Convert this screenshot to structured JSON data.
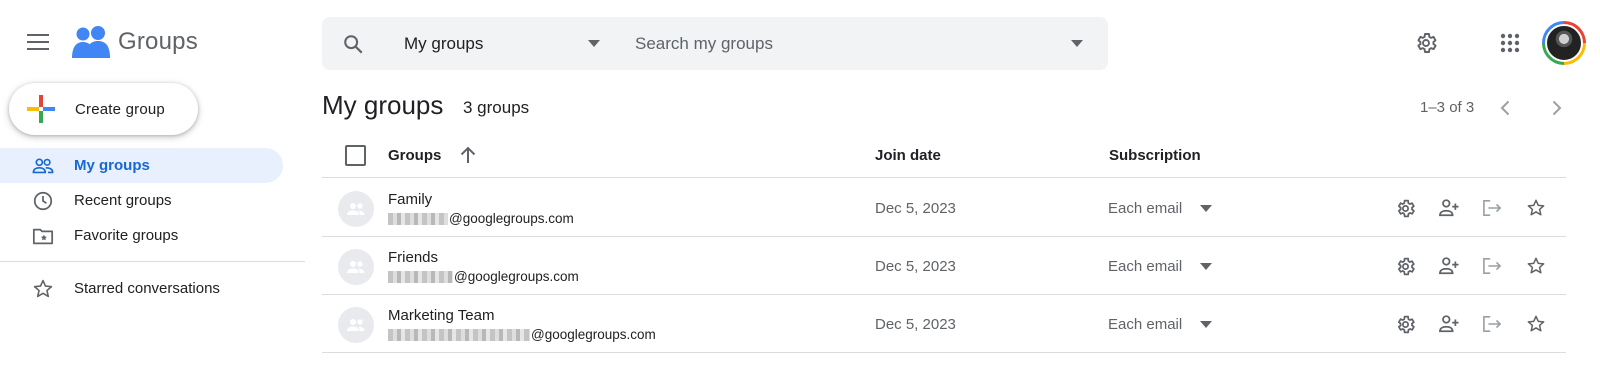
{
  "app": {
    "title": "Groups"
  },
  "search": {
    "scope": "My groups",
    "placeholder": "Search my groups"
  },
  "create_button": {
    "label": "Create group"
  },
  "sidebar": {
    "items": [
      {
        "label": "My groups",
        "icon": "people-icon",
        "active": true
      },
      {
        "label": "Recent groups",
        "icon": "clock-icon"
      },
      {
        "label": "Favorite groups",
        "icon": "folder-star-icon"
      },
      {
        "label": "Starred conversations",
        "icon": "star-icon"
      }
    ]
  },
  "main": {
    "title": "My groups",
    "count": "3 groups",
    "pagination": "1–3 of 3",
    "columns": {
      "groups": "Groups",
      "join_date": "Join date",
      "subscription": "Subscription"
    },
    "rows": [
      {
        "name": "Family",
        "email_domain": "@googlegroups.com",
        "join_date": "Dec 5, 2023",
        "subscription": "Each email"
      },
      {
        "name": "Friends",
        "email_domain": "@googlegroups.com",
        "join_date": "Dec 5, 2023",
        "subscription": "Each email"
      },
      {
        "name": "Marketing Team",
        "email_domain": "@googlegroups.com",
        "join_date": "Dec 5, 2023",
        "subscription": "Each email"
      }
    ]
  },
  "colors": {
    "accent": "#1967d2",
    "active_bg": "#e8f0fe",
    "logo_blue": "#4285f4",
    "google_red": "#ea4335",
    "google_yellow": "#fbbc04",
    "google_green": "#34a853"
  }
}
